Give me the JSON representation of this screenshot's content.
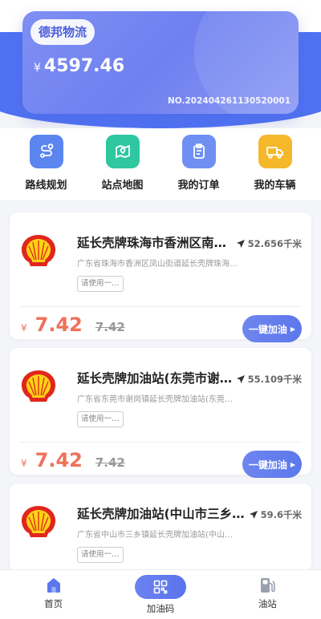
{
  "card": {
    "company": "德邦物流",
    "currency": "¥",
    "balance": "4597.46",
    "number": "NO.20240426113052​0001"
  },
  "quick_actions": [
    {
      "label": "路线规划",
      "icon": "route-icon",
      "color": "#5b86f0"
    },
    {
      "label": "站点地图",
      "icon": "map-pin-icon",
      "color": "#2ec7a0"
    },
    {
      "label": "我的订单",
      "icon": "clipboard-icon",
      "color": "#6f8ff3"
    },
    {
      "label": "我的车辆",
      "icon": "truck-icon",
      "color": "#f4b82a"
    }
  ],
  "stations": [
    {
      "name": "延长壳牌珠海市香洲区南…",
      "distance": "52.656千米",
      "address": "广东省珠海市香洲区凤山街道延长壳牌珠海…",
      "tag": "请使用一…",
      "currency": "¥",
      "price": "7.42",
      "original_price": "7.42",
      "button": "一键加油"
    },
    {
      "name": "延长壳牌加油站(东莞市谢…",
      "distance": "55.109千米",
      "address": "广东省东莞市谢岗镇延长壳牌加油站(东莞市…",
      "tag": "请使用一…",
      "currency": "¥",
      "price": "7.42",
      "original_price": "7.42",
      "button": "一键加油"
    },
    {
      "name": "延长壳牌加油站(中山市三乡…",
      "distance": "59.6千米",
      "address": "广东省中山市三乡镇延长壳牌加油站(中山市三乡…",
      "tag": "请使用一…"
    }
  ],
  "tabbar": [
    {
      "label": "首页",
      "icon": "home-icon",
      "active": true
    },
    {
      "label": "加油码",
      "icon": "qr-code-icon"
    },
    {
      "label": "油站",
      "icon": "fuel-pump-icon"
    }
  ],
  "colors": {
    "accent": "#5c78ec",
    "price": "#f0705a",
    "card": "#7b8cf2"
  }
}
